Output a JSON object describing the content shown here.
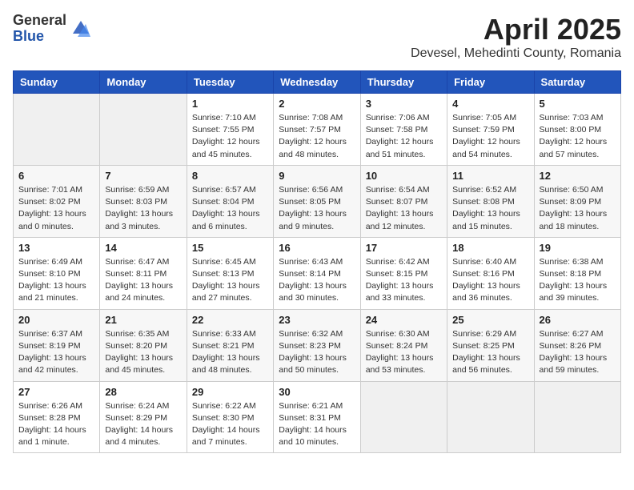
{
  "logo": {
    "general": "General",
    "blue": "Blue"
  },
  "title": {
    "month_year": "April 2025",
    "location": "Devesel, Mehedinti County, Romania"
  },
  "weekdays": [
    "Sunday",
    "Monday",
    "Tuesday",
    "Wednesday",
    "Thursday",
    "Friday",
    "Saturday"
  ],
  "weeks": [
    [
      {
        "day": "",
        "info": ""
      },
      {
        "day": "",
        "info": ""
      },
      {
        "day": "1",
        "info": "Sunrise: 7:10 AM\nSunset: 7:55 PM\nDaylight: 12 hours\nand 45 minutes."
      },
      {
        "day": "2",
        "info": "Sunrise: 7:08 AM\nSunset: 7:57 PM\nDaylight: 12 hours\nand 48 minutes."
      },
      {
        "day": "3",
        "info": "Sunrise: 7:06 AM\nSunset: 7:58 PM\nDaylight: 12 hours\nand 51 minutes."
      },
      {
        "day": "4",
        "info": "Sunrise: 7:05 AM\nSunset: 7:59 PM\nDaylight: 12 hours\nand 54 minutes."
      },
      {
        "day": "5",
        "info": "Sunrise: 7:03 AM\nSunset: 8:00 PM\nDaylight: 12 hours\nand 57 minutes."
      }
    ],
    [
      {
        "day": "6",
        "info": "Sunrise: 7:01 AM\nSunset: 8:02 PM\nDaylight: 13 hours\nand 0 minutes."
      },
      {
        "day": "7",
        "info": "Sunrise: 6:59 AM\nSunset: 8:03 PM\nDaylight: 13 hours\nand 3 minutes."
      },
      {
        "day": "8",
        "info": "Sunrise: 6:57 AM\nSunset: 8:04 PM\nDaylight: 13 hours\nand 6 minutes."
      },
      {
        "day": "9",
        "info": "Sunrise: 6:56 AM\nSunset: 8:05 PM\nDaylight: 13 hours\nand 9 minutes."
      },
      {
        "day": "10",
        "info": "Sunrise: 6:54 AM\nSunset: 8:07 PM\nDaylight: 13 hours\nand 12 minutes."
      },
      {
        "day": "11",
        "info": "Sunrise: 6:52 AM\nSunset: 8:08 PM\nDaylight: 13 hours\nand 15 minutes."
      },
      {
        "day": "12",
        "info": "Sunrise: 6:50 AM\nSunset: 8:09 PM\nDaylight: 13 hours\nand 18 minutes."
      }
    ],
    [
      {
        "day": "13",
        "info": "Sunrise: 6:49 AM\nSunset: 8:10 PM\nDaylight: 13 hours\nand 21 minutes."
      },
      {
        "day": "14",
        "info": "Sunrise: 6:47 AM\nSunset: 8:11 PM\nDaylight: 13 hours\nand 24 minutes."
      },
      {
        "day": "15",
        "info": "Sunrise: 6:45 AM\nSunset: 8:13 PM\nDaylight: 13 hours\nand 27 minutes."
      },
      {
        "day": "16",
        "info": "Sunrise: 6:43 AM\nSunset: 8:14 PM\nDaylight: 13 hours\nand 30 minutes."
      },
      {
        "day": "17",
        "info": "Sunrise: 6:42 AM\nSunset: 8:15 PM\nDaylight: 13 hours\nand 33 minutes."
      },
      {
        "day": "18",
        "info": "Sunrise: 6:40 AM\nSunset: 8:16 PM\nDaylight: 13 hours\nand 36 minutes."
      },
      {
        "day": "19",
        "info": "Sunrise: 6:38 AM\nSunset: 8:18 PM\nDaylight: 13 hours\nand 39 minutes."
      }
    ],
    [
      {
        "day": "20",
        "info": "Sunrise: 6:37 AM\nSunset: 8:19 PM\nDaylight: 13 hours\nand 42 minutes."
      },
      {
        "day": "21",
        "info": "Sunrise: 6:35 AM\nSunset: 8:20 PM\nDaylight: 13 hours\nand 45 minutes."
      },
      {
        "day": "22",
        "info": "Sunrise: 6:33 AM\nSunset: 8:21 PM\nDaylight: 13 hours\nand 48 minutes."
      },
      {
        "day": "23",
        "info": "Sunrise: 6:32 AM\nSunset: 8:23 PM\nDaylight: 13 hours\nand 50 minutes."
      },
      {
        "day": "24",
        "info": "Sunrise: 6:30 AM\nSunset: 8:24 PM\nDaylight: 13 hours\nand 53 minutes."
      },
      {
        "day": "25",
        "info": "Sunrise: 6:29 AM\nSunset: 8:25 PM\nDaylight: 13 hours\nand 56 minutes."
      },
      {
        "day": "26",
        "info": "Sunrise: 6:27 AM\nSunset: 8:26 PM\nDaylight: 13 hours\nand 59 minutes."
      }
    ],
    [
      {
        "day": "27",
        "info": "Sunrise: 6:26 AM\nSunset: 8:28 PM\nDaylight: 14 hours\nand 1 minute."
      },
      {
        "day": "28",
        "info": "Sunrise: 6:24 AM\nSunset: 8:29 PM\nDaylight: 14 hours\nand 4 minutes."
      },
      {
        "day": "29",
        "info": "Sunrise: 6:22 AM\nSunset: 8:30 PM\nDaylight: 14 hours\nand 7 minutes."
      },
      {
        "day": "30",
        "info": "Sunrise: 6:21 AM\nSunset: 8:31 PM\nDaylight: 14 hours\nand 10 minutes."
      },
      {
        "day": "",
        "info": ""
      },
      {
        "day": "",
        "info": ""
      },
      {
        "day": "",
        "info": ""
      }
    ]
  ]
}
